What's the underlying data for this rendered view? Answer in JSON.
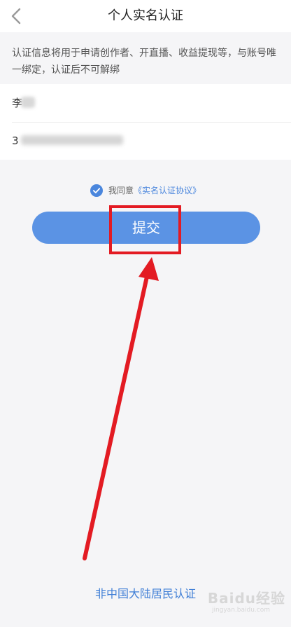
{
  "header": {
    "title": "个人实名认证",
    "back_icon": "chevron-left-icon"
  },
  "notice": {
    "text": "认证信息将用于申请创作者、开直播、收益提现等，与账号唯一绑定，认证后不可解绑"
  },
  "form": {
    "name_prefix": "李",
    "id_prefix": "3"
  },
  "agreement": {
    "checked": true,
    "prefix": "我同意",
    "link_text": "《实名认证协议》"
  },
  "submit": {
    "label": "提交"
  },
  "footer": {
    "link_text": "非中国大陆居民认证"
  },
  "watermark": {
    "text": "Baidu经验",
    "subtext": "jingyan.baidu.com"
  },
  "colors": {
    "accent": "#5b93e4",
    "link": "#3f7ed6",
    "annotation": "#e31b23",
    "background": "#f5f5f7"
  }
}
